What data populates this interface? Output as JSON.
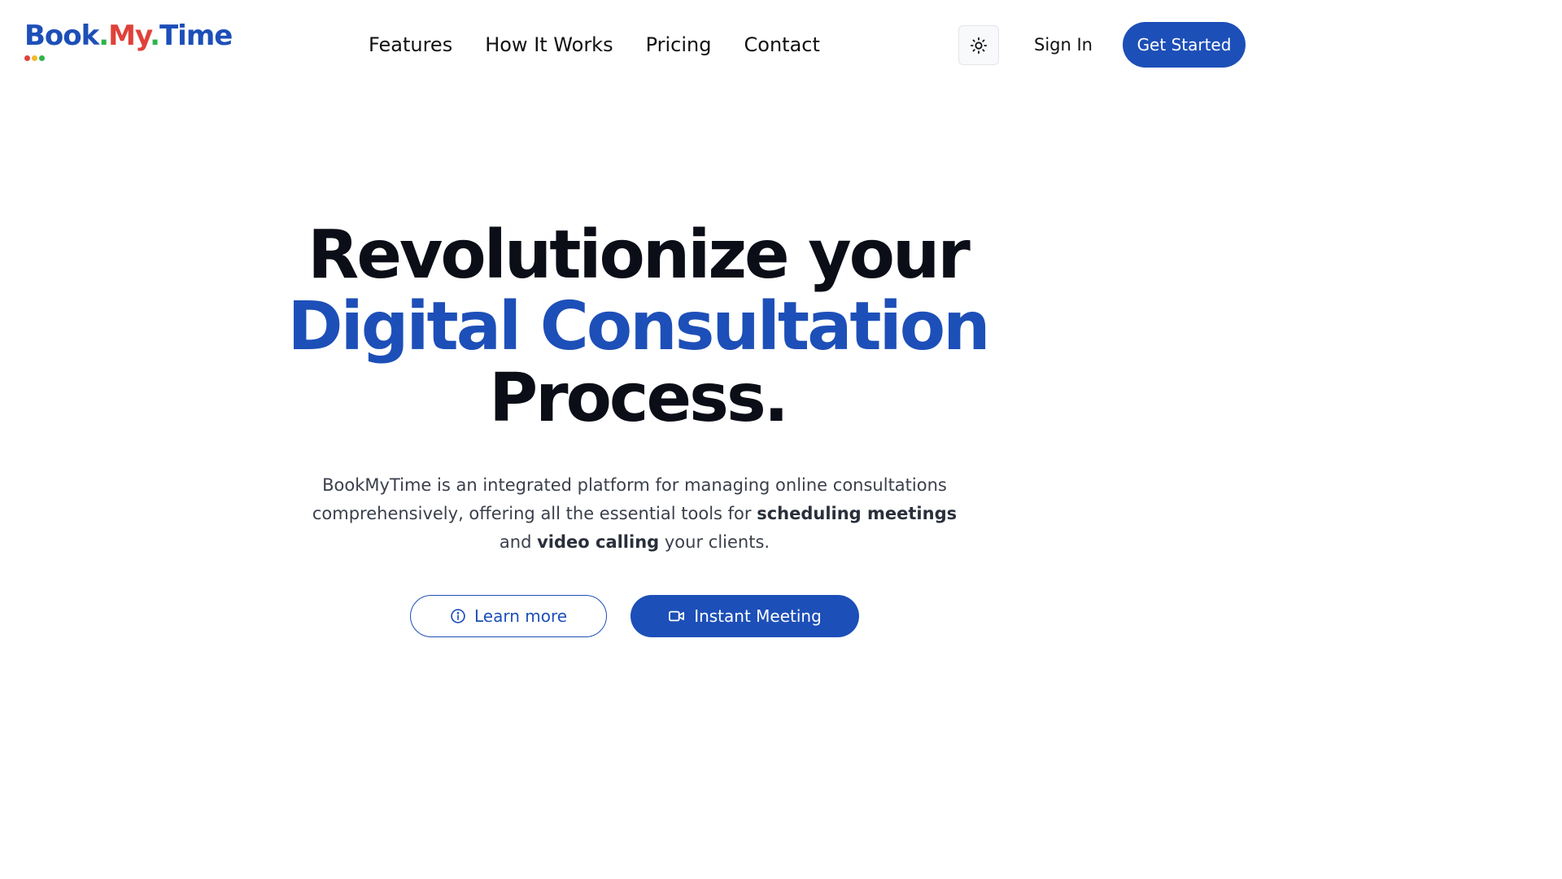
{
  "brand": {
    "part1": "Book",
    "dot1": ".",
    "part2": "My",
    "dot2": ".",
    "part3": "Time",
    "colors": {
      "blue": "#1d4fb8",
      "red": "#e0413a",
      "green": "#2fb34a",
      "yellow": "#f2b92a"
    }
  },
  "nav": {
    "items": [
      {
        "label": "Features"
      },
      {
        "label": "How It Works"
      },
      {
        "label": "Pricing"
      },
      {
        "label": "Contact"
      }
    ]
  },
  "header_actions": {
    "theme_toggle_icon": "sun-icon",
    "sign_in": "Sign In",
    "get_started": "Get Started"
  },
  "hero": {
    "title_line1": "Revolutionize your",
    "title_line2": "Digital Consultation",
    "title_line3": "Process.",
    "desc_part1": "BookMyTime is an integrated platform for managing online consultations comprehensively, offering all the essential tools for ",
    "desc_bold1": "scheduling meetings",
    "desc_part2": " and ",
    "desc_bold2": "video calling",
    "desc_part3": " your clients.",
    "learn_more": "Learn more",
    "learn_more_icon": "info-icon",
    "instant_meeting": "Instant Meeting",
    "instant_meeting_icon": "video-icon"
  }
}
